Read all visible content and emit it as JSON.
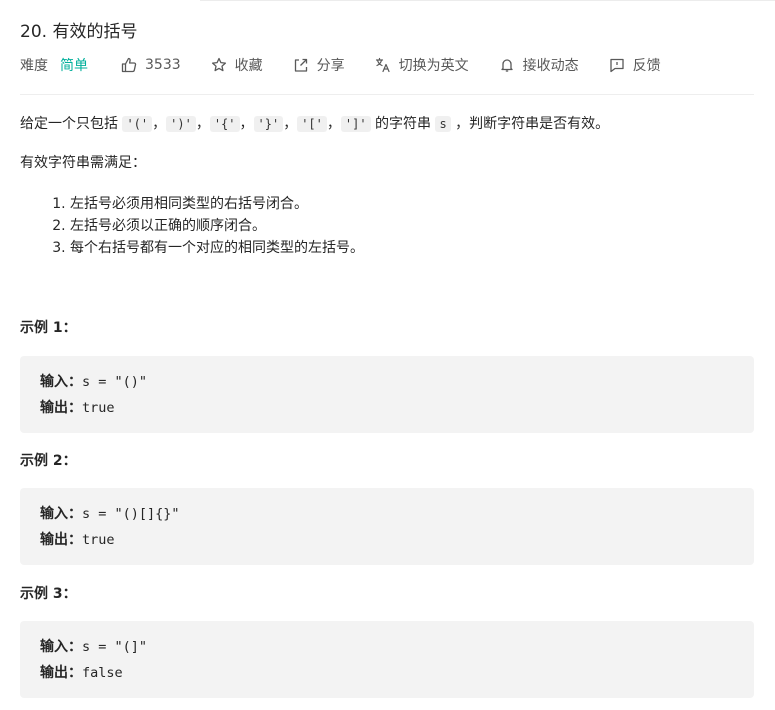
{
  "problem": {
    "title": "20. 有效的括号",
    "difficulty_label": "难度",
    "difficulty": "简单",
    "likes": "3533",
    "actions": {
      "favorite": "收藏",
      "share": "分享",
      "switch_lang": "切换为英文",
      "subscribe": "接收动态",
      "feedback": "反馈"
    },
    "icons": {
      "likes": "thumbs-up-icon",
      "favorite": "star-icon",
      "share": "share-icon",
      "switch_lang": "translate-icon",
      "subscribe": "bell-icon",
      "feedback": "feedback-icon"
    },
    "colors": {
      "difficulty": "#00af9b",
      "text": "#262626",
      "muted": "#595959",
      "code_bg": "#f3f3f3"
    }
  },
  "description": {
    "prefix": "给定一个只包括 ",
    "chars": [
      "'('",
      "')'",
      "'{'",
      "'}'",
      "'['",
      "']'"
    ],
    "sep": "，",
    "mid": " 的字符串 ",
    "var": "s",
    "suffix": " ，判断字符串是否有效。"
  },
  "requirements": {
    "heading": "有效字符串需满足：",
    "items": [
      "左括号必须用相同类型的右括号闭合。",
      "左括号必须以正确的顺序闭合。",
      "每个右括号都有一个对应的相同类型的左括号。"
    ]
  },
  "examples": [
    {
      "title": "示例 1：",
      "input_label": "输入：",
      "input": "s = \"()\"",
      "output_label": "输出：",
      "output": "true"
    },
    {
      "title": "示例 2：",
      "input_label": "输入：",
      "input": "s = \"()[]{}\"",
      "output_label": "输出：",
      "output": "true"
    },
    {
      "title": "示例 3：",
      "input_label": "输入：",
      "input": "s = \"(]\"",
      "output_label": "输出：",
      "output": "false"
    }
  ]
}
